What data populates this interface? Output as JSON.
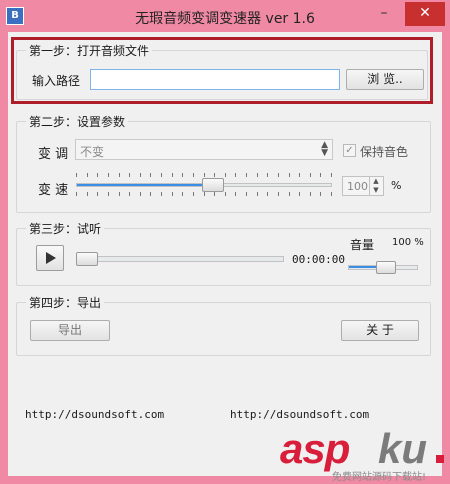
{
  "window": {
    "title": "无瑕音频变调变速器 ver 1.6",
    "icon_text": "B",
    "minimize": "–",
    "maximize": "□",
    "close": "✕"
  },
  "step1": {
    "title": "第一步：打开音频文件",
    "path_label": "输入路径",
    "path_value": "",
    "browse_button": "浏  览.."
  },
  "step2": {
    "title": "第二步：设置参数",
    "pitch_label": "变 调",
    "pitch_selected": "不变",
    "keep_tone_label": "保持音色",
    "keep_tone_checked": true,
    "speed_label": "变 速",
    "speed_value": "100",
    "speed_unit": "%",
    "speed_slider_fraction": 0.5
  },
  "step3": {
    "title": "第三步：试听",
    "play_icon": "play-icon",
    "time": "00:00:00",
    "volume_label": "音量",
    "volume_value": "100 %",
    "progress_fraction": 0.0,
    "volume_fraction": 0.5
  },
  "step4": {
    "title": "第四步：导出",
    "export_button": "导出",
    "close_button": "关  于"
  },
  "footer": {
    "url_left": "http://dsoundsoft.com",
    "url_right": "http://dsoundsoft.com"
  },
  "watermark": {
    "brand_a": "asp",
    "brand_b": "ku",
    "tagline": "免费网站源码下载站!"
  },
  "colors": {
    "window_frame": "#f08aa4",
    "highlight_box": "#b01d2a",
    "slider_fill": "#3a8ee6"
  }
}
